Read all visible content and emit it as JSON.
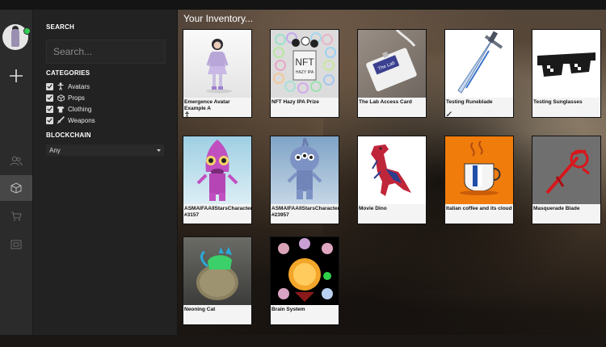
{
  "filters": {
    "search_heading": "SEARCH",
    "search_placeholder": "Search...",
    "categories_heading": "CATEGORIES",
    "categories": [
      {
        "label": "Avatars",
        "checked": true,
        "icon": "avatar-icon"
      },
      {
        "label": "Props",
        "checked": true,
        "icon": "cube-icon"
      },
      {
        "label": "Clothing",
        "checked": true,
        "icon": "shirt-icon"
      },
      {
        "label": "Weapons",
        "checked": true,
        "icon": "sword-icon"
      }
    ],
    "blockchain_heading": "BLOCKCHAIN",
    "blockchain_value": "Any"
  },
  "inventory": {
    "title": "Your Inventory...",
    "items": [
      {
        "name": "Emergence Avatar Example A",
        "category_icon": "avatar-icon"
      },
      {
        "name": "NFT Hazy IPA Prize"
      },
      {
        "name": "The Lab Access Card"
      },
      {
        "name": "Testing Runeblade",
        "category_icon": "sword-icon"
      },
      {
        "name": "Testing Sunglasses"
      },
      {
        "name": "ASMAIFAAllStarsCharacter #3157"
      },
      {
        "name": "ASMAIFAAllStarsCharacter #23957"
      },
      {
        "name": "Movie Dino"
      },
      {
        "name": "Italian coffee and its cloud"
      },
      {
        "name": "Masquerade Blade"
      },
      {
        "name": "Neoning Cat"
      },
      {
        "name": "Brain System"
      }
    ]
  },
  "thumb_text": {
    "nft_sign": "NFT",
    "nft_sub": "HAZY IPA",
    "lab_card": "The Lab"
  },
  "colors": {
    "online": "#33cc55",
    "rail_bg": "#2b2b2b",
    "panel_bg": "#222222",
    "active_tab": "#474747"
  }
}
